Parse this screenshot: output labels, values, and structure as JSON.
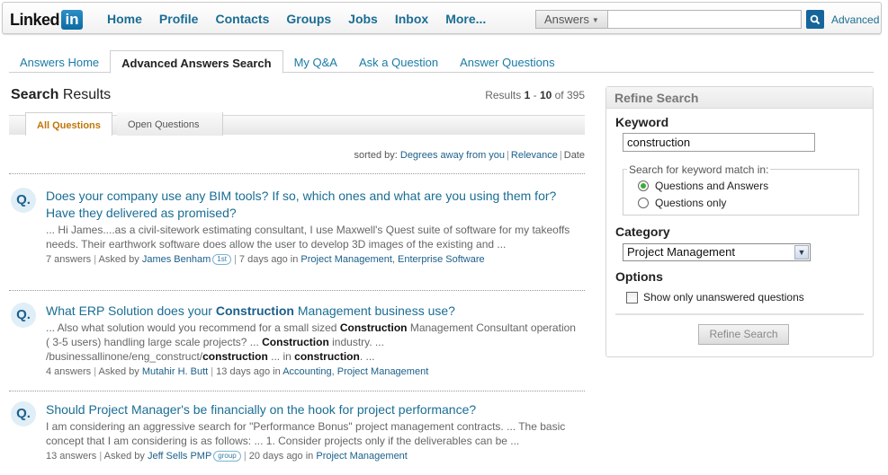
{
  "header": {
    "logo_text": "Linked",
    "logo_badge": "in",
    "nav": [
      "Home",
      "Profile",
      "Contacts",
      "Groups",
      "Jobs",
      "Inbox",
      "More..."
    ],
    "search_scope": "Answers",
    "search_value": "",
    "search_icon": "magnifier-icon",
    "advanced_label": "Advanced"
  },
  "tabs": [
    {
      "label": "Answers Home",
      "active": false
    },
    {
      "label": "Advanced Answers Search",
      "active": true
    },
    {
      "label": "My Q&A",
      "active": false
    },
    {
      "label": "Ask a Question",
      "active": false
    },
    {
      "label": "Answer Questions",
      "active": false
    }
  ],
  "results": {
    "title_bold": "Search",
    "title_rest": " Results",
    "count_prefix": "Results ",
    "count_from": "1",
    "count_dash": " - ",
    "count_to": "10",
    "count_of": " of 395",
    "subtabs": [
      "All Questions",
      "Open Questions"
    ],
    "sorted_label": "sorted by: ",
    "sort_options": [
      "Degrees away from you",
      "Relevance",
      "Date"
    ]
  },
  "questions": [
    {
      "badge": "Q.",
      "title": "Does your company use any BIM tools? If so, which ones and what are you using them for? Have they delivered as promised?",
      "snippet": "... Hi James....as a civil-sitework estimating consultant, I use Maxwell's Quest suite of software for my takeoffs needs. Their earthwork software does allow the user to develop 3D images of the existing and ...",
      "answers": "7 answers",
      "asked_by_label": "Asked by ",
      "author": "James Benham",
      "author_badge": "1st",
      "age": "7 days ago in ",
      "categories": [
        "Project Management",
        "Enterprise Software"
      ]
    },
    {
      "badge": "Q.",
      "title_parts": [
        "What ERP Solution does your ",
        "Construction",
        " Management business use?"
      ],
      "snippet_parts": [
        "... Also what solution would you recommend for a small sized ",
        "Construction",
        " Management Consultant operation ( 3-5 users) handling large scale projects? ... ",
        "Construction",
        " industry. ... /businessallinone/eng_construct/",
        "construction",
        " ... in ",
        "construction",
        ". ..."
      ],
      "answers": "4 answers",
      "asked_by_label": "Asked by ",
      "author": "Mutahir H. Butt",
      "age": "13 days ago in ",
      "categories": [
        "Accounting",
        "Project Management"
      ]
    },
    {
      "badge": "Q.",
      "title": "Should Project Manager's be financially on the hook for project performance?",
      "snippet": "I am considering an aggressive search for \"Performance Bonus\" project management contracts. ... The basic concept that I am considering is as follows: ... 1. Consider projects only if the deliverables can be ...",
      "answers": "13 answers",
      "asked_by_label": "Asked by ",
      "author": "Jeff Sells PMP",
      "author_badge": "group",
      "age": "20 days ago in ",
      "categories": [
        "Project Management"
      ]
    }
  ],
  "refine": {
    "title": "Refine Search",
    "keyword_label": "Keyword",
    "keyword_value": "construction",
    "match_legend": "Search for keyword match in:",
    "match_options": [
      {
        "label": "Questions and Answers",
        "selected": true
      },
      {
        "label": "Questions only",
        "selected": false
      }
    ],
    "category_label": "Category",
    "category_value": "Project Management",
    "options_label": "Options",
    "unanswered_label": "Show only unanswered questions",
    "unanswered_checked": false,
    "button_label": "Refine Search"
  }
}
